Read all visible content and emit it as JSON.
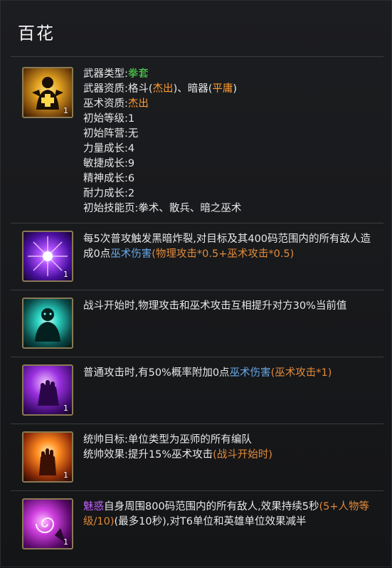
{
  "hero": {
    "name": "百花"
  },
  "stats": {
    "weapon_type_label": "武器类型:",
    "weapon_type": "拳套",
    "weapon_quality_label": "武器资质:",
    "weapon_quality_a": "格斗(",
    "weapon_quality_a_grade": "杰出",
    "weapon_quality_sep": ")、暗器(",
    "weapon_quality_b_grade": "平庸",
    "weapon_quality_end": ")",
    "sorcery_quality_label": "巫术资质:",
    "sorcery_quality": "杰出",
    "initial_level": "初始等级:1",
    "initial_camp": "初始阵营:无",
    "strength": "力量成长:4",
    "agility": "敏捷成长:9",
    "spirit": "精神成长:6",
    "endurance": "耐力成长:2",
    "skill_pages": "初始技能页:拳术、散兵、暗之巫术",
    "icon": "buff-figure-icon",
    "level": "1"
  },
  "skills": [
    {
      "icon": "purple-burst-icon",
      "level": "1",
      "t1": "每5次普攻触发",
      "t2": "黑暗炸裂",
      "t3": ",对目标及其400码范围内的所有敌人造成0点",
      "t4": "巫术伤害",
      "t5": "(物理攻击*0.5+巫术攻击*0.5)"
    },
    {
      "icon": "teal-aura-icon",
      "level": "",
      "t1": "战斗开始时,物理攻击和巫术攻击互相提升对方30%当前值"
    },
    {
      "icon": "violet-fist-icon",
      "level": "1",
      "t1": "普通攻击时,有50%概率附加0点",
      "t2": "巫术伤害",
      "t3": "(巫术攻击*1)"
    },
    {
      "icon": "flame-hand-icon",
      "level": "1",
      "t1": "统帅目标:单位类型为",
      "t2": "巫师",
      "t3": "的所有编队",
      "t4": "统帅效果:提升15%巫术攻击",
      "t5": "(战斗开始时)"
    },
    {
      "icon": "charm-swirl-icon",
      "level": "1",
      "t1": "魅惑",
      "t2": "自身周围800码范围内的所有敌人,效果持续5秒",
      "t3": "(5+人物等级/10)",
      "t4": "(最多10秒),对",
      "t5": "T6",
      "t6": "单位和",
      "t7": "英雄单位",
      "t8": "效果减半"
    }
  ],
  "colors": {
    "green": "#4fe04f",
    "orange": "#ff9a2e",
    "blue": "#67a8e6",
    "purple": "#c060ff"
  }
}
